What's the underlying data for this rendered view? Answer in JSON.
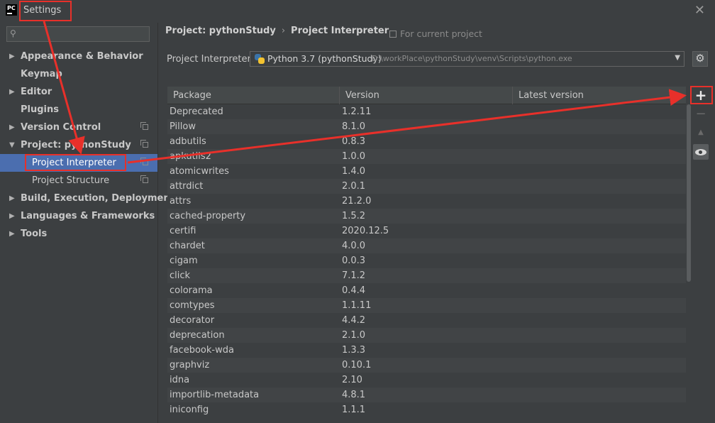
{
  "window": {
    "title": "Settings",
    "app_icon": "PC"
  },
  "sidebar": {
    "search_placeholder": "",
    "items": [
      {
        "label": "Appearance & Behavior",
        "arrow": "▶",
        "level": 0
      },
      {
        "label": "Keymap",
        "arrow": "",
        "level": 0
      },
      {
        "label": "Editor",
        "arrow": "▶",
        "level": 0
      },
      {
        "label": "Plugins",
        "arrow": "",
        "level": 0
      },
      {
        "label": "Version Control",
        "arrow": "▶",
        "level": 0
      },
      {
        "label": "Project: pythonStudy",
        "arrow": "▼",
        "level": 0
      },
      {
        "label": "Project Interpreter",
        "arrow": "",
        "level": 1
      },
      {
        "label": "Project Structure",
        "arrow": "",
        "level": 1
      },
      {
        "label": "Build, Execution, Deployment",
        "arrow": "▶",
        "level": 0
      },
      {
        "label": "Languages & Frameworks",
        "arrow": "▶",
        "level": 0
      },
      {
        "label": "Tools",
        "arrow": "▶",
        "level": 0
      }
    ]
  },
  "breadcrumb": {
    "project": "Project: pythonStudy",
    "separator": "›",
    "page": "Project Interpreter"
  },
  "for_current_project": "For current project",
  "interpreter": {
    "label": "Project Interpreter:",
    "name": "Python 3.7 (pythonStudy)",
    "path": "D:\\workPlace\\pythonStudy\\venv\\Scripts\\python.exe"
  },
  "table": {
    "headers": {
      "package": "Package",
      "version": "Version",
      "latest": "Latest version"
    },
    "rows": [
      {
        "package": "Deprecated",
        "version": "1.2.11"
      },
      {
        "package": "Pillow",
        "version": "8.1.0"
      },
      {
        "package": "adbutils",
        "version": "0.8.3"
      },
      {
        "package": "apkutils2",
        "version": "1.0.0"
      },
      {
        "package": "atomicwrites",
        "version": "1.4.0"
      },
      {
        "package": "attrdict",
        "version": "2.0.1"
      },
      {
        "package": "attrs",
        "version": "21.2.0"
      },
      {
        "package": "cached-property",
        "version": "1.5.2"
      },
      {
        "package": "certifi",
        "version": "2020.12.5"
      },
      {
        "package": "chardet",
        "version": "4.0.0"
      },
      {
        "package": "cigam",
        "version": "0.0.3"
      },
      {
        "package": "click",
        "version": "7.1.2"
      },
      {
        "package": "colorama",
        "version": "0.4.4"
      },
      {
        "package": "comtypes",
        "version": "1.1.11"
      },
      {
        "package": "decorator",
        "version": "4.4.2"
      },
      {
        "package": "deprecation",
        "version": "2.1.0"
      },
      {
        "package": "facebook-wda",
        "version": "1.3.3"
      },
      {
        "package": "graphviz",
        "version": "0.10.1"
      },
      {
        "package": "idna",
        "version": "2.10"
      },
      {
        "package": "importlib-metadata",
        "version": "4.8.1"
      },
      {
        "package": "iniconfig",
        "version": "1.1.1"
      }
    ]
  },
  "tools": {
    "add": "+",
    "remove": "−",
    "up": "▲"
  },
  "colors": {
    "background": "#3c3f41",
    "selection": "#4b6eaf",
    "annotation": "#e8302a"
  }
}
